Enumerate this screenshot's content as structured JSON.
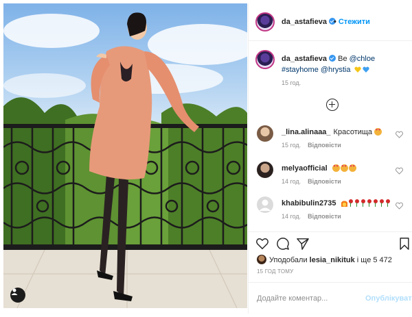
{
  "post": {
    "author": "da_astafieva",
    "follow_label": "Стежити",
    "dot": "•"
  },
  "caption": {
    "author": "da_astafieva",
    "text_prefix": "Be ",
    "mention_brand": "@chloe",
    "hashtag": "#stayhome",
    "mention_user": "@hrystia",
    "emoji_hearts": [
      "yellow-heart",
      "blue-heart"
    ],
    "time": "15 год."
  },
  "comments": [
    {
      "username": "_lina.alinaaa_",
      "text": "Красотища",
      "emoji": [
        "heart-eyes"
      ],
      "time": "15 год.",
      "reply": "Відповісти"
    },
    {
      "username": "melyaofficial",
      "text": "",
      "emoji": [
        "heart-eyes",
        "heart-eyes",
        "heart-eyes"
      ],
      "time": "14 год.",
      "reply": "Відповісти"
    },
    {
      "username": "khabibulin2735",
      "text": "",
      "emoji": [
        "fire",
        "rose",
        "rose",
        "rose",
        "rose",
        "rose",
        "rose",
        "rose"
      ],
      "time": "14 год.",
      "reply": "Відповісти"
    }
  ],
  "actions": {
    "likes_prefix": "Уподобали",
    "likes_user": "lesia_nikituk",
    "likes_suffix": "і ще 5 472",
    "post_time": "15 ГОД ТОМУ"
  },
  "add_comment": {
    "placeholder": "Додайте коментар...",
    "publish": "Опублікувати"
  },
  "colors": {
    "link": "#00376b",
    "follow": "#0095f6",
    "publish_disabled": "#b2dffc",
    "muted": "#8e8e8e",
    "border": "#efefef"
  }
}
